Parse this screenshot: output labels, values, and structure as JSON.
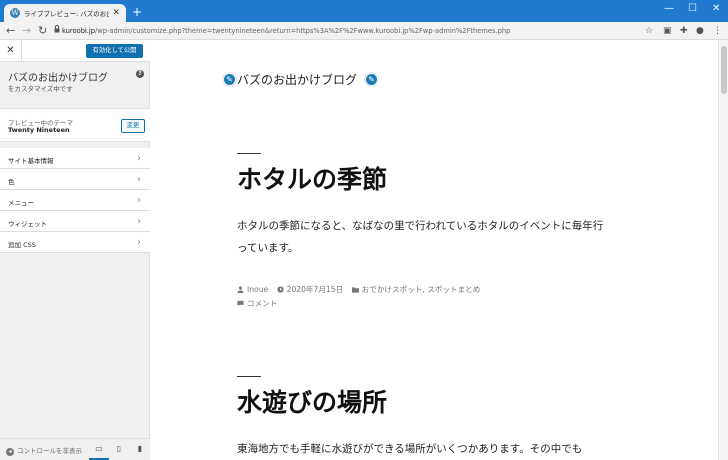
{
  "browser": {
    "tab_title": "ライブプレビュー: バズのお出かけブログ",
    "url_host": "kuroobi.jp",
    "url_path": "/wp-admin/customize.php?theme=twentynineteen&return=https%3A%2F%2Fwww.kuroobi.jp%2Fwp-admin%2Fthemes.php"
  },
  "sidebar": {
    "publish_label": "有効化して公開",
    "site_title": "バズのお出かけブログ",
    "site_subtitle": "をカスタマイズ中です",
    "theme_label": "プレビュー中のテーマ",
    "theme_name": "Twenty Nineteen",
    "change_label": "変更",
    "menu_items": [
      {
        "label": "サイト基本情報"
      },
      {
        "label": "色"
      },
      {
        "label": "メニュー"
      },
      {
        "label": "ウィジェット"
      },
      {
        "label": "追加 CSS"
      }
    ],
    "hide_controls_label": "コントロールを非表示"
  },
  "preview": {
    "blog_title": "バズのお出かけブログ",
    "posts": [
      {
        "title": "ホタルの季節",
        "excerpt": "ホタルの季節になると、なばなの里で行われているホタルのイベントに毎年行っています。",
        "author": "Inoue",
        "date": "2020年7月15日",
        "categories": "おでかけスポット, スポットまとめ",
        "comments": "コメント"
      },
      {
        "title": "水遊びの場所",
        "excerpt": "東海地方でも手軽に水遊びができる場所がいくつかあります。その中でも"
      }
    ]
  },
  "colors": {
    "tabbar": "#1f7ad0",
    "accent": "#1070b0",
    "edit_pencil": "#1b7bb5"
  }
}
